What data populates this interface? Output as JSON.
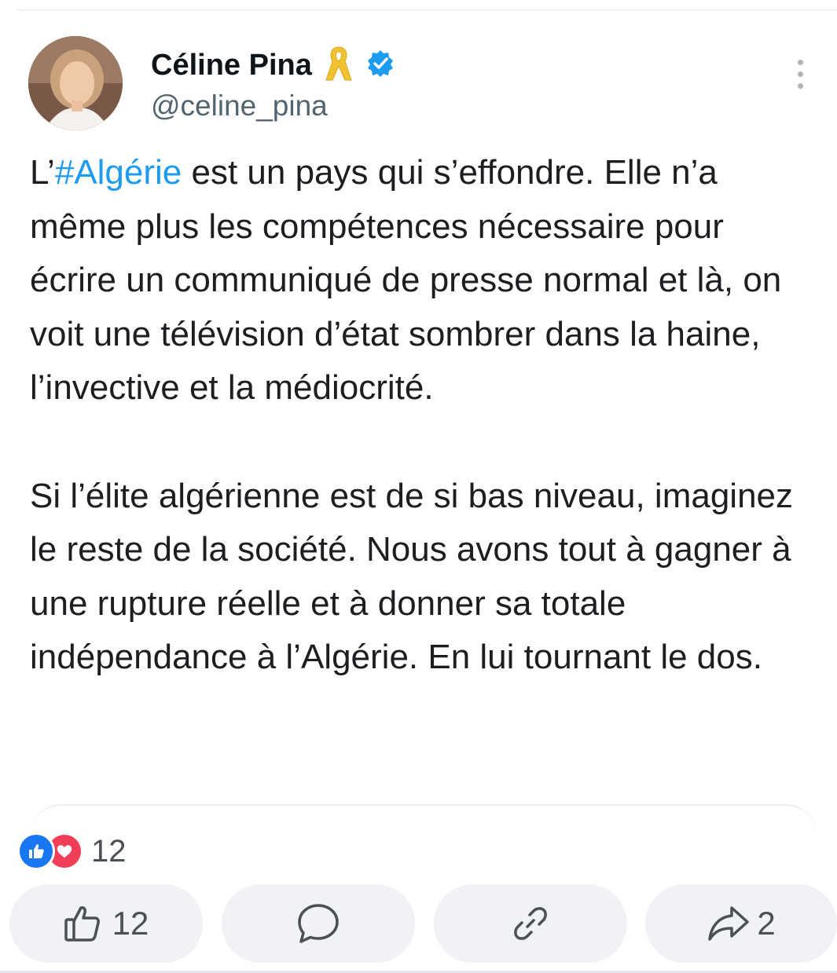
{
  "post": {
    "author_name": "Céline Pina",
    "handle": "@celine_pina",
    "paragraph1_prefix": "L’",
    "hashtag": "#Algérie",
    "paragraph1_rest": " est un pays qui s’effondre. Elle n’a même plus les compétences nécessaire pour écrire un communiqué de presse normal et là, on voit une télévision d’état sombrer dans la haine, l’invective et la médiocrité.",
    "paragraph2": "Si l’élite algérienne est de si bas niveau, imaginez le reste de la société. Nous avons tout à gagner à une rupture réelle et à donner sa totale indépendance à l’Algérie. En lui tournant le dos."
  },
  "reactions": {
    "icons": [
      "thumbs-up",
      "heart"
    ],
    "count": "12"
  },
  "actions": {
    "like_count": "12",
    "share_count": "2"
  },
  "colors": {
    "hashtag": "#1d9bf0",
    "verified": "#1d9bf0",
    "ribbon": "#f2c230",
    "like": "#1877f2",
    "love": "#f33e58",
    "pill": "#f0f2f5"
  }
}
